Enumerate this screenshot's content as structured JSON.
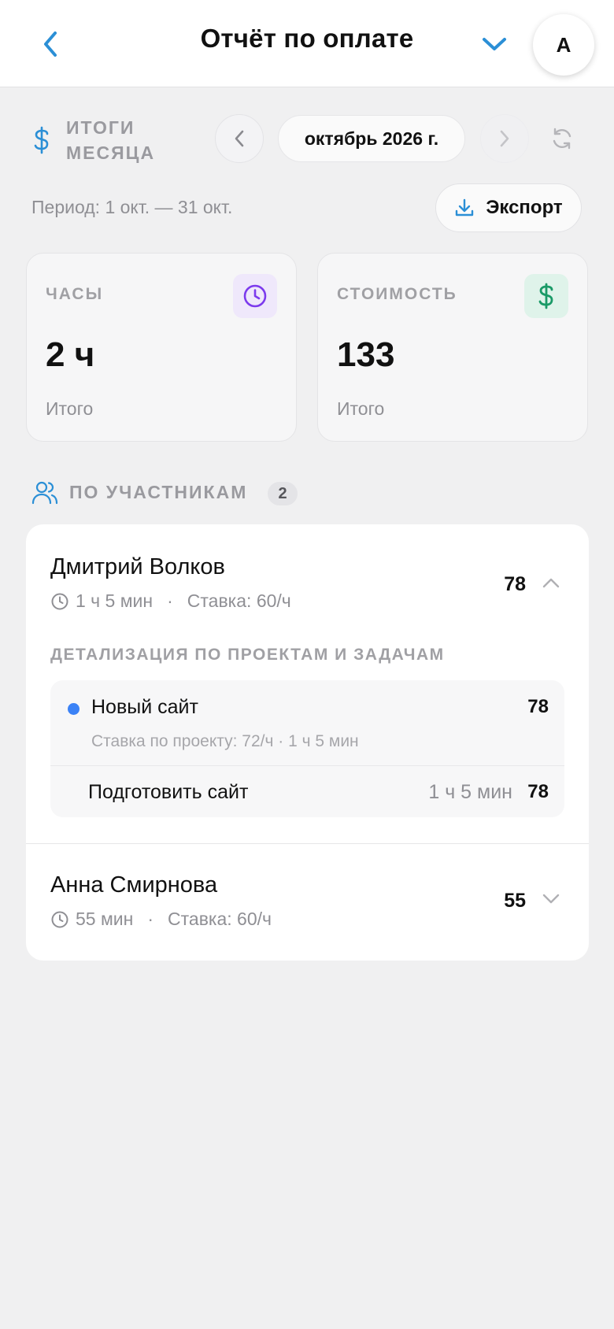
{
  "header": {
    "title": "Отчёт по оплате",
    "avatar_letter": "A",
    "accent_color": "#2b8fd6"
  },
  "month": {
    "section_title": "ИТОГИ МЕСЯЦА",
    "selected": "октябрь 2026 г.",
    "period": "Период: 1 окт. — 31 окт.",
    "export_label": "Экспорт"
  },
  "stats": {
    "hours": {
      "label": "ЧАСЫ",
      "value": "2 ч",
      "sub": "Итого",
      "icon": "clock-icon",
      "icon_color": "#7c3aed"
    },
    "cost": {
      "label": "СТОИМОСТЬ",
      "value": "133",
      "sub": "Итого",
      "icon": "dollar-icon",
      "icon_color": "#1a9a67"
    }
  },
  "participants": {
    "title": "ПО УЧАСТНИКАМ",
    "count": "2",
    "members": [
      {
        "name": "Дмитрий Волков",
        "time": "1 ч 5 мин",
        "rate": "Ставка: 60/ч",
        "amount": "78",
        "expanded": true,
        "detail_title": "ДЕТАЛИЗАЦИЯ ПО ПРОЕКТАМ И ЗАДАЧАМ",
        "projects": [
          {
            "name": "Новый сайт",
            "amount": "78",
            "meta": "Ставка по проекту: 72/ч  ·  1 ч 5 мин",
            "color": "#3b82f6",
            "tasks": [
              {
                "name": "Подготовить сайт",
                "time": "1 ч 5 мин",
                "amount": "78"
              }
            ]
          }
        ]
      },
      {
        "name": "Анна Смирнова",
        "time": "55 мин",
        "rate": "Ставка: 60/ч",
        "amount": "55",
        "expanded": false
      }
    ]
  },
  "separator": "·"
}
